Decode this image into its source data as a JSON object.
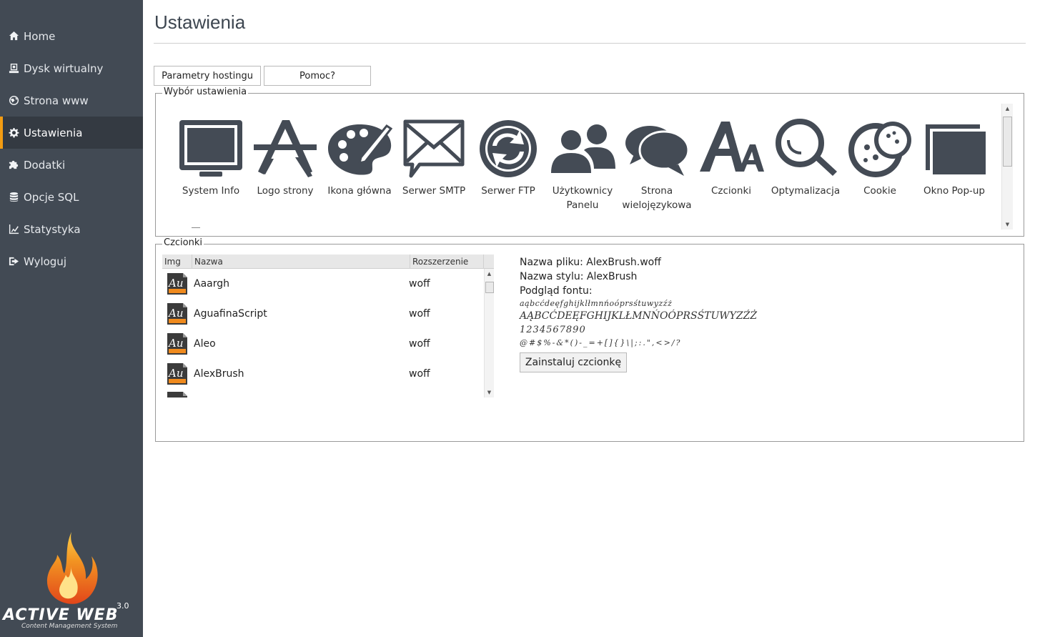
{
  "sidebar": {
    "items": [
      {
        "label": "Home",
        "icon": "home-icon"
      },
      {
        "label": "Dysk wirtualny",
        "icon": "disk-icon"
      },
      {
        "label": "Strona www",
        "icon": "globe-icon"
      },
      {
        "label": "Ustawienia",
        "icon": "gear-icon",
        "active": true
      },
      {
        "label": "Dodatki",
        "icon": "puzzle-icon"
      },
      {
        "label": "Opcje SQL",
        "icon": "database-icon"
      },
      {
        "label": "Statystyka",
        "icon": "chart-icon"
      },
      {
        "label": "Wyloguj",
        "icon": "logout-icon"
      }
    ],
    "logo": {
      "name": "ACTIVE WEB",
      "version": "3.0",
      "subtitle": "Content Management System"
    }
  },
  "page": {
    "title": "Ustawienia",
    "buttons": {
      "hosting": "Parametry hostingu",
      "help": "Pomoc?"
    }
  },
  "settings_panel": {
    "legend": "Wybór ustawienia",
    "items": [
      {
        "label": "System Info",
        "icon": "monitor-icon"
      },
      {
        "label": "Logo strony",
        "icon": "app-store-icon"
      },
      {
        "label": "Ikona główna",
        "icon": "palette-icon"
      },
      {
        "label": "Serwer SMTP",
        "icon": "envelope-icon"
      },
      {
        "label": "Serwer FTP",
        "icon": "sync-icon"
      },
      {
        "label": "Użytkownicy Panelu",
        "icon": "users-icon"
      },
      {
        "label": "Strona wielojęzykowa",
        "icon": "speech-bubbles-icon"
      },
      {
        "label": "Czcionki",
        "icon": "font-icon"
      },
      {
        "label": "Optymalizacja",
        "icon": "magnifier-icon"
      },
      {
        "label": "Cookie",
        "icon": "cookie-icon"
      },
      {
        "label": "Okno Pop-up",
        "icon": "window-icon"
      }
    ]
  },
  "fonts_panel": {
    "legend": "Czcionki",
    "columns": {
      "img": "Img",
      "name": "Nazwa",
      "ext": "Rozszerzenie"
    },
    "rows": [
      {
        "name": "Aaargh",
        "ext": "woff"
      },
      {
        "name": "AguafinaScript",
        "ext": "woff"
      },
      {
        "name": "Aleo",
        "ext": "woff"
      },
      {
        "name": "AlexBrush",
        "ext": "woff"
      }
    ],
    "file_icon_text": "Au",
    "detail": {
      "file_name": "Nazwa pliku: AlexBrush.woff",
      "style_name": "Nazwa stylu: AlexBrush",
      "preview_label": "Podgląd fontu:",
      "preview_lower": "aąbcćdeęfghijklłmnńoóprsśtuwyzźż",
      "preview_upper": "AĄBCĆDEĘFGHIJKLŁMNŃOÓPRSŚTUWYZŹŻ",
      "preview_digits": "1234567890",
      "preview_symbols": "@#$%-&*()-_=+[]{}\\|;:.\",<>/?",
      "install_button": "Zainstaluj czcionkę"
    }
  },
  "colors": {
    "sidebar": "#424a54",
    "sidebar_active": "#343a42",
    "accent": "#f39c12",
    "icon": "#444b55"
  }
}
